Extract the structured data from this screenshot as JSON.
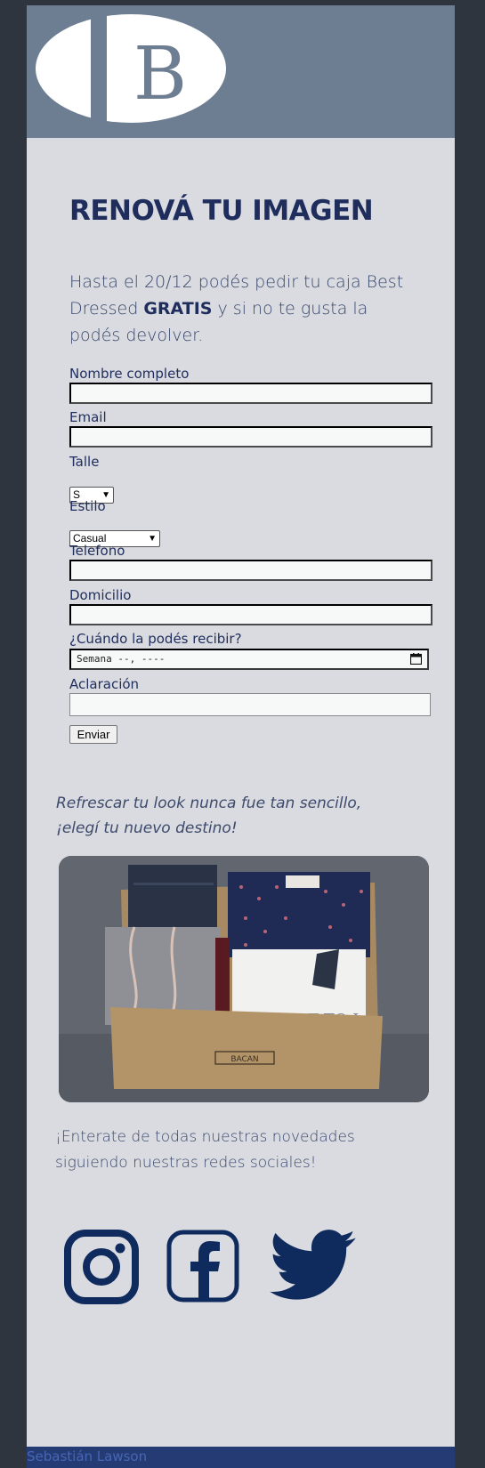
{
  "header": {
    "logo_letter": "B"
  },
  "hero": {
    "title": "RENOVÁ TU IMAGEN",
    "intro_before": "Hasta el 20/12 podés pedir tu caja Best Dressed ",
    "intro_bold": "GRATIS",
    "intro_after": " y si no te gusta la podés devolver."
  },
  "form": {
    "name_label": "Nombre completo",
    "name_value": "",
    "email_label": "Email",
    "email_value": "",
    "size_label": "Talle",
    "size_value": "S",
    "style_label": "Estilo",
    "style_value": "Casual",
    "phone_label": "Telefono",
    "phone_value": "",
    "address_label": "Domicilio",
    "address_value": "",
    "date_label": "¿Cuándo la podés recibir?",
    "date_placeholder": "Semana --, ----",
    "note_label": "Aclaración",
    "note_value": "",
    "submit_label": "Enviar"
  },
  "promo": {
    "tagline_line1": "Refrescar tu look nunca fue tan sencillo,",
    "tagline_line2": "¡elegí tu nuevo destino!",
    "box_brand": "BACAN"
  },
  "social": {
    "text": "¡Enterate de todas nuestras novedades siguiendo nuestras redes sociales!",
    "icons": [
      "instagram-icon",
      "facebook-icon",
      "twitter-icon"
    ],
    "icon_color": "#0f2a5c"
  },
  "footer": {
    "author": "Sebastián Lawson"
  },
  "colors": {
    "background": "#2f353f",
    "page": "#d9dbe0",
    "header": "#6e7e92",
    "title": "#1f2d5c",
    "footer": "#243b74"
  }
}
